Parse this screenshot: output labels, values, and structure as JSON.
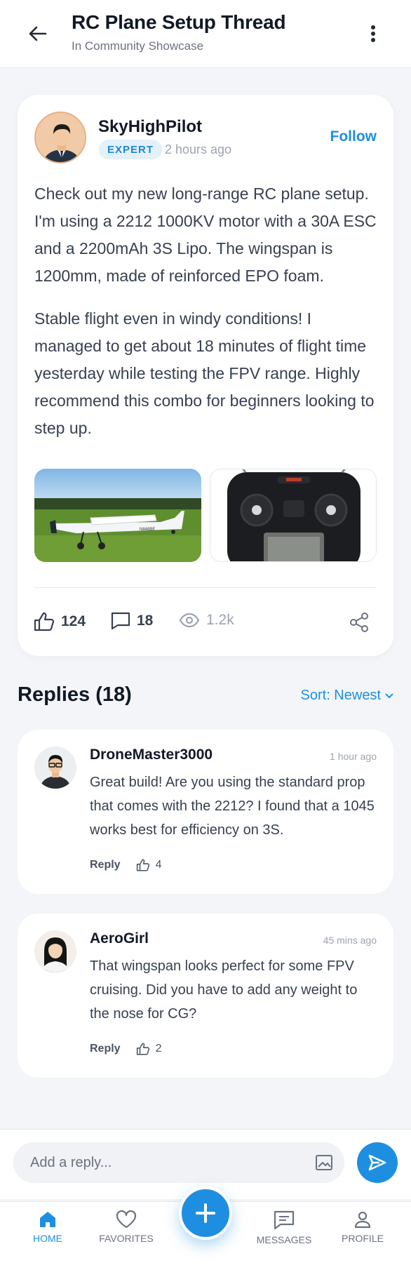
{
  "header": {
    "title": "RC Plane Setup Thread",
    "subtitle": "In Community Showcase"
  },
  "post": {
    "author": "SkyHighPilot",
    "badge": "EXPERT",
    "time": "2 hours ago",
    "follow_label": "Follow",
    "paragraphs": [
      "Check out my new long-range RC plane setup. I'm using a 2212 1000KV motor with a 30A ESC and a 2200mAh 3S Lipo. The wingspan is 1200mm, made of reinforced EPO foam.",
      "Stable flight even in windy conditions! I managed to get about 18 minutes of flight time yesterday while testing the FPV range. Highly recommend this combo for beginners looking to step up."
    ],
    "images": [
      "rc-plane-photo",
      "radio-transmitter-photo"
    ],
    "plane_marking": "N848BE",
    "stats": {
      "likes": "124",
      "comments": "18",
      "views": "1.2k"
    }
  },
  "replies_section": {
    "title": "Replies (18)",
    "sort_label": "Sort: Newest"
  },
  "replies": [
    {
      "author": "DroneMaster3000",
      "time": "1 hour ago",
      "text": "Great build! Are you using the standard prop that comes with the 2212? I found that a 1045 works best for efficiency on 3S.",
      "reply_label": "Reply",
      "likes": "4"
    },
    {
      "author": "AeroGirl",
      "time": "45 mins ago",
      "text": "That wingspan looks perfect for some FPV cruising. Did you have to add any weight to the nose for CG?",
      "reply_label": "Reply",
      "likes": "2"
    }
  ],
  "composer": {
    "placeholder": "Add a reply..."
  },
  "nav": {
    "home": "HOME",
    "favorites": "FAVORITES",
    "messages": "MESSAGES",
    "profile": "PROFILE"
  },
  "colors": {
    "accent": "#1e8fe0",
    "badge_bg": "#e3f1fb",
    "background": "#f3f5f8"
  }
}
